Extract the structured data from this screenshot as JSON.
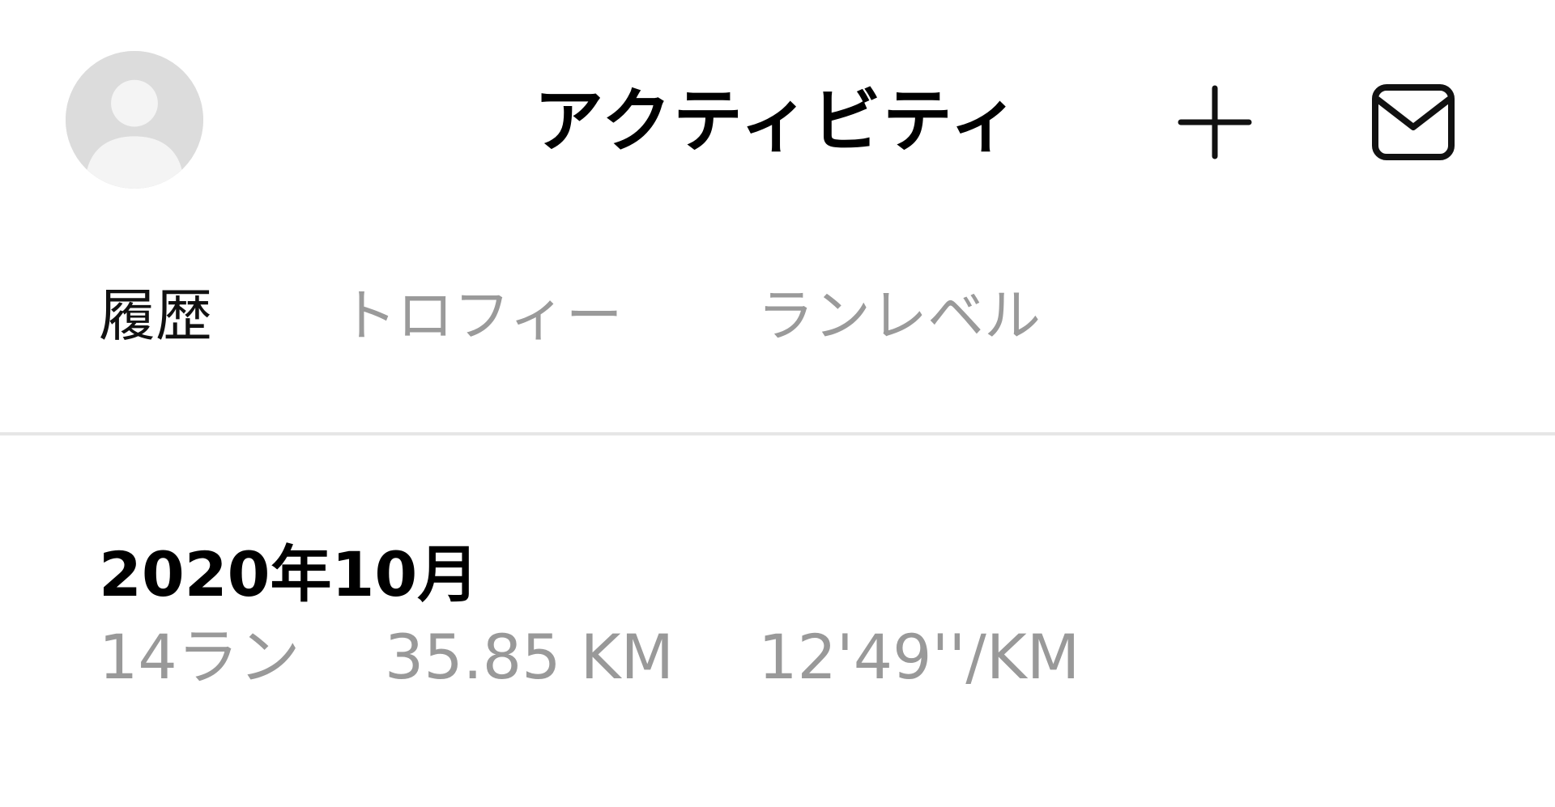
{
  "header": {
    "title": "アクティビティ",
    "avatar_icon": "user-avatar-placeholder",
    "add_icon": "plus-icon",
    "inbox_icon": "mail-icon"
  },
  "tabs": [
    {
      "label": "履歴",
      "active": true
    },
    {
      "label": "トロフィー",
      "active": false
    },
    {
      "label": "ランレベル",
      "active": false
    }
  ],
  "history": {
    "month": "2020年10月",
    "runs": "14ラン",
    "distance": "35.85 KM",
    "pace": "12'49''/KM"
  },
  "colors": {
    "active_text": "#111111",
    "inactive_text": "#9a9a9a",
    "divider": "#e6e6e6",
    "avatar_bg": "#dcdcdc"
  }
}
